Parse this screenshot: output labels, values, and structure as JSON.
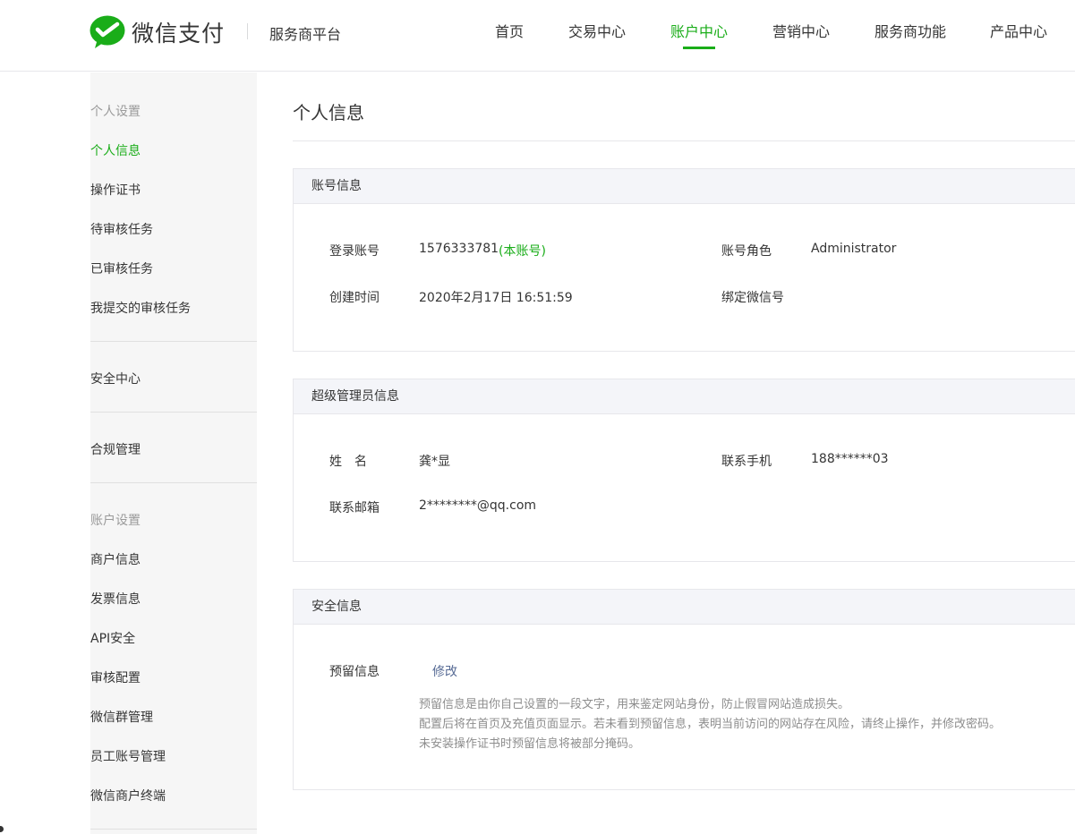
{
  "header": {
    "brand": "微信支付",
    "platform": "服务商平台",
    "nav": [
      "首页",
      "交易中心",
      "账户中心",
      "营销中心",
      "服务商功能",
      "产品中心"
    ],
    "active_nav": "账户中心",
    "accent_color": "#1aad19"
  },
  "sidebar": {
    "group1_title": "个人设置",
    "group1_items": [
      "个人信息",
      "操作证书",
      "待审核任务",
      "已审核任务",
      "我提交的审核任务"
    ],
    "security": "安全中心",
    "compliance": "合规管理",
    "group2_title": "账户设置",
    "group2_items": [
      "商户信息",
      "发票信息",
      "API安全",
      "审核配置",
      "微信群管理",
      "员工账号管理",
      "微信商户终端"
    ],
    "active_item": "个人信息"
  },
  "main": {
    "title": "个人信息",
    "account": {
      "heading": "账号信息",
      "login_label": "登录账号",
      "login_value": "1576333781",
      "login_tag": "(本账号)",
      "role_label": "账号角色",
      "role_value": "Administrator",
      "created_label": "创建时间",
      "created_value": "2020年2月17日 16:51:59",
      "wechat_label": "绑定微信号"
    },
    "admin": {
      "heading": "超级管理员信息",
      "name_label": "姓　名",
      "name_value": "龚*显",
      "phone_label": "联系手机",
      "phone_value": "188******03",
      "email_label": "联系邮箱",
      "email_value": "2********@qq.com"
    },
    "security": {
      "heading": "安全信息",
      "reserved_label": "预留信息",
      "modify_link": "修改",
      "notes": [
        "预留信息是由你自己设置的一段文字，用来鉴定网站身份，防止假冒网站造成损失。",
        "配置后将在首页及充值页面显示。若未看到预留信息，表明当前访问的网站存在风险，请终止操作，并修改密码。",
        "未安装操作证书时预留信息将被部分掩码。"
      ]
    }
  }
}
